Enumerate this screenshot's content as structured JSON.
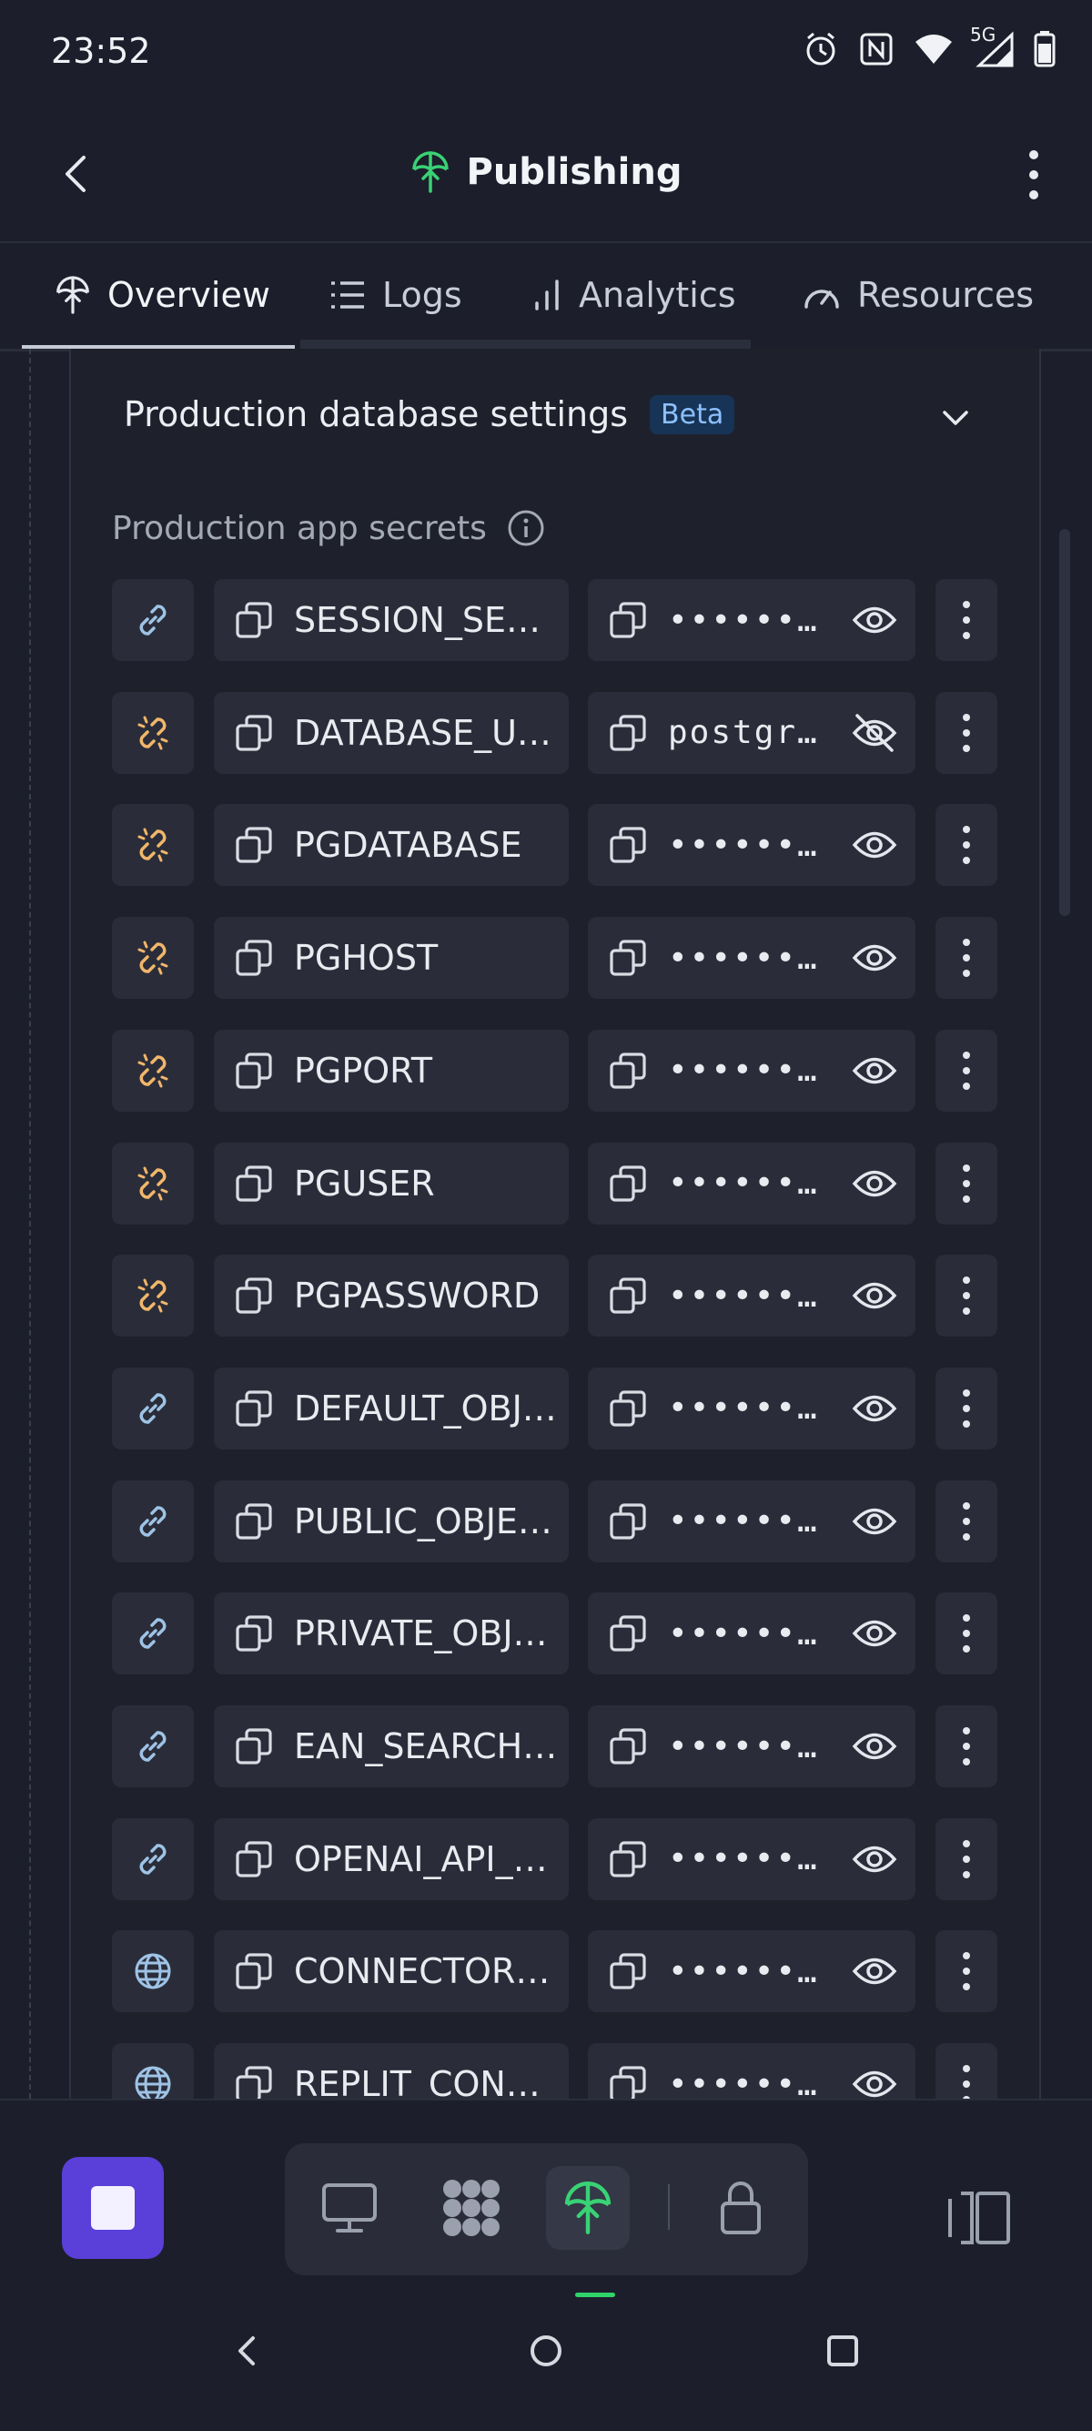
{
  "status_bar": {
    "time": "23:52",
    "network_label": "5G",
    "icons": [
      "alarm-icon",
      "nfc-icon",
      "wifi-icon",
      "signal-icon",
      "battery-icon"
    ]
  },
  "app_bar": {
    "title": "Publishing",
    "title_icon": "publishing-icon",
    "back_icon": "back-arrow-icon",
    "menu_icon": "more-vertical-icon"
  },
  "tabs": [
    {
      "label": "Overview",
      "icon": "publishing-icon",
      "active": true
    },
    {
      "label": "Logs",
      "icon": "list-icon",
      "active": false
    },
    {
      "label": "Analytics",
      "icon": "bar-chart-icon",
      "active": false
    },
    {
      "label": "Resources",
      "icon": "gauge-icon",
      "active": false
    }
  ],
  "section": {
    "title": "Production database settings",
    "badge": "Beta"
  },
  "secrets_label": "Production app secrets",
  "secrets": [
    {
      "key": "SESSION_SECRET",
      "value": "••••••••",
      "link": "link",
      "visible": false
    },
    {
      "key": "DATABASE_URL",
      "value": "postgresql://",
      "link": "broken-link",
      "visible": true
    },
    {
      "key": "PGDATABASE",
      "value": "••••••••",
      "link": "broken-link",
      "visible": false
    },
    {
      "key": "PGHOST",
      "value": "••••••••",
      "link": "broken-link",
      "visible": false
    },
    {
      "key": "PGPORT",
      "value": "••••••••",
      "link": "broken-link",
      "visible": false
    },
    {
      "key": "PGUSER",
      "value": "••••••••",
      "link": "broken-link",
      "visible": false
    },
    {
      "key": "PGPASSWORD",
      "value": "••••••••",
      "link": "broken-link",
      "visible": false
    },
    {
      "key": "DEFAULT_OBJECT_STORAGE",
      "value": "••••••••",
      "link": "link",
      "visible": false
    },
    {
      "key": "PUBLIC_OBJECT_SEARCH",
      "value": "••••••••",
      "link": "link",
      "visible": false
    },
    {
      "key": "PRIVATE_OBJECT_DIR",
      "value": "••••••••",
      "link": "link",
      "visible": false
    },
    {
      "key": "EAN_SEARCH_TOKEN",
      "value": "••••••••",
      "link": "link",
      "visible": false
    },
    {
      "key": "OPENAI_API_KEY",
      "value": "••••••••",
      "link": "link",
      "visible": false
    },
    {
      "key": "CONNECTORS_HOSTNAME",
      "value": "••••••••",
      "link": "globe",
      "visible": false
    },
    {
      "key": "REPLIT_CONNECTORS",
      "value": "••••••••",
      "link": "globe",
      "visible": false
    }
  ],
  "colors": {
    "background": "#1c1f2b",
    "card": "#2a2d39",
    "link_icon": "#9ec3e6",
    "broken_link_icon": "#f2b66b",
    "accent_green": "#2fd46a",
    "stop_purple": "#5a3fd8",
    "badge_bg": "#173355",
    "badge_text": "#8cc1ff"
  },
  "bottom_nav": {
    "items": [
      "stop-icon",
      "monitor-icon",
      "workflow-icon",
      "publishing-icon",
      "lock-icon",
      "layout-icon"
    ],
    "active": "publishing-icon"
  }
}
